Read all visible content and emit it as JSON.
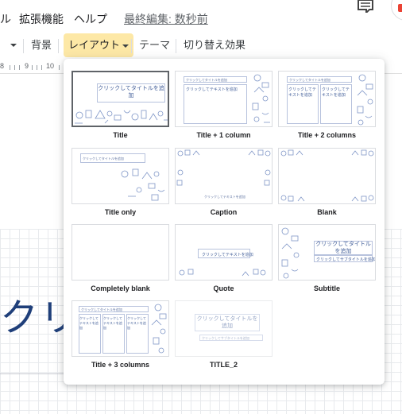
{
  "menubar": {
    "partial_menu": "ル",
    "extensions": "拡張機能",
    "help": "ヘルプ",
    "last_edit": "最終編集: 数秒前"
  },
  "toolbar": {
    "background": "背景",
    "layout": "レイアウト",
    "theme": "テーマ",
    "transition": "切り替え効果"
  },
  "ruler": {
    "labels": [
      "8",
      "9",
      "10"
    ]
  },
  "canvas": {
    "title_fragment": "クリ"
  },
  "layouts": [
    {
      "label": "Title",
      "selected": true
    },
    {
      "label": "Title + 1 column"
    },
    {
      "label": "Title + 2 columns"
    },
    {
      "label": "Title only"
    },
    {
      "label": "Caption"
    },
    {
      "label": "Blank"
    },
    {
      "label": "Completely blank"
    },
    {
      "label": "Quote"
    },
    {
      "label": "Subtitle"
    },
    {
      "label": "Title + 3 columns"
    },
    {
      "label": "TITLE_2"
    }
  ],
  "thumb_text": {
    "click_title": "クリックしてタイトルを追加",
    "click_text": "クリックしてテキストを追加",
    "click_subtitle": "クリックしてサブタイトルを追加",
    "tiny_title": "クリックしてタイトルを追加",
    "tiny_text": "クリックしてテキストを追加"
  },
  "colors": {
    "accent": "#fde8a6",
    "doodle": "#7f96c7",
    "title_blue": "#1f3f7a"
  }
}
